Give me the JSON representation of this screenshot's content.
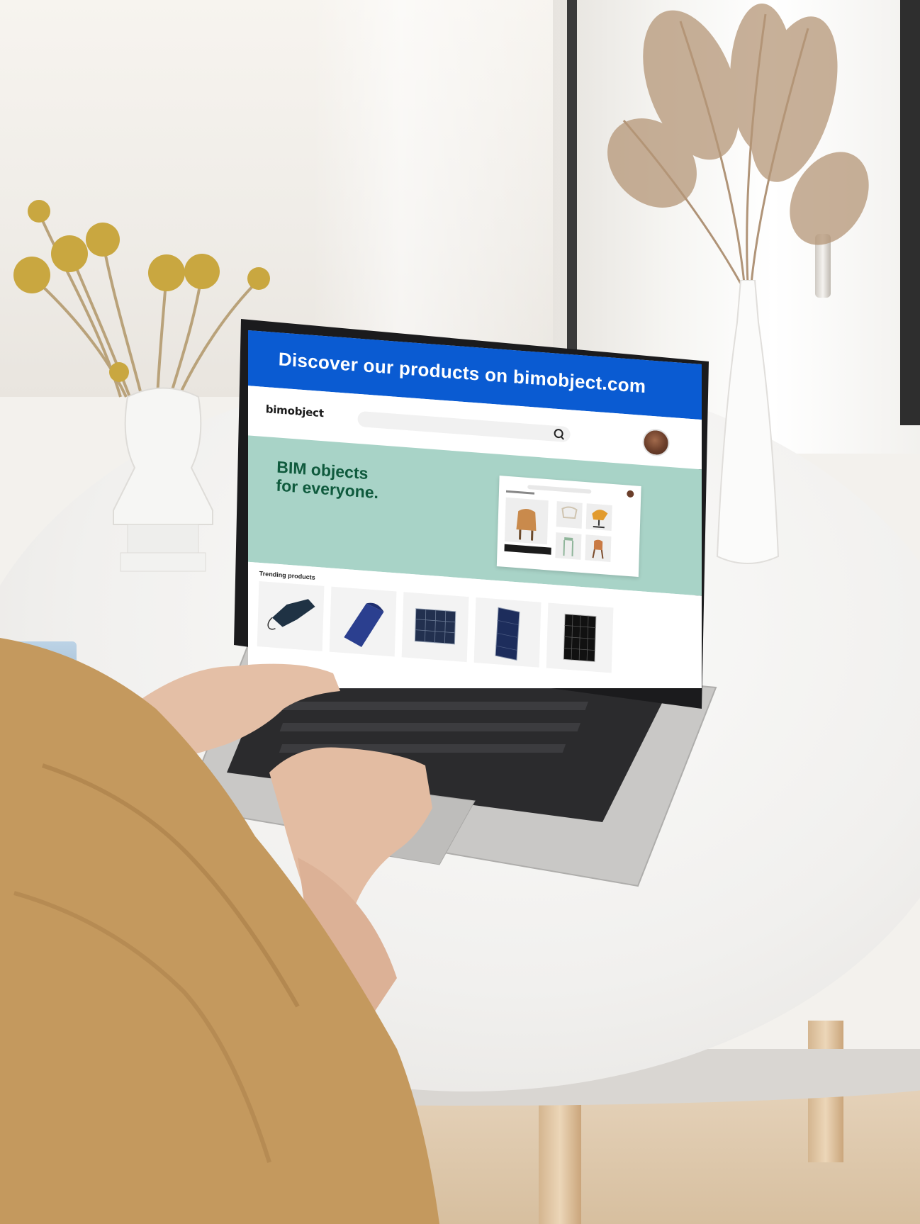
{
  "screen": {
    "banner_text": "Discover our products on bimobject.com",
    "logo_text": "bimobject",
    "hero_line1": "BIM objects",
    "hero_line2": "for everyone.",
    "trending_title": "Trending products",
    "trending_items": [
      "flexible-solar-mat",
      "flexible-solar-roll",
      "solar-panel-square",
      "solar-panel-tall",
      "solar-panel-black"
    ],
    "colors": {
      "banner": "#0a5bd2",
      "hero": "#a8d3c7",
      "hero_text": "#0f5a3d"
    }
  }
}
